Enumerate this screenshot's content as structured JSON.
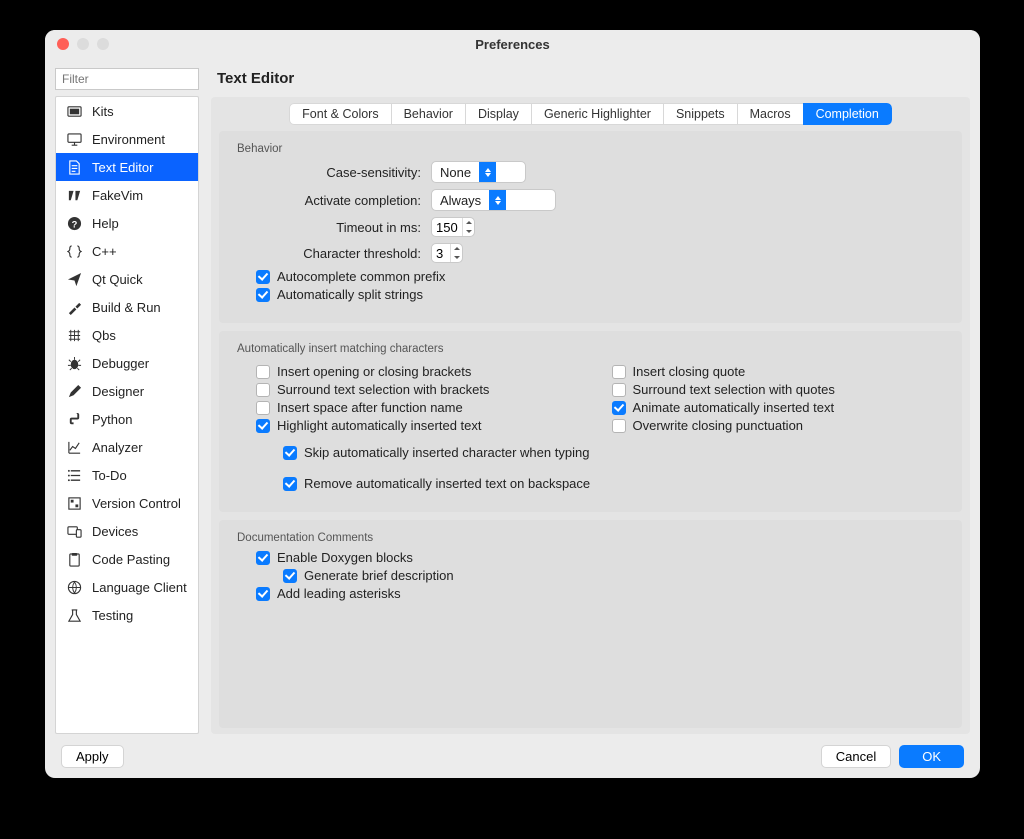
{
  "window": {
    "title": "Preferences"
  },
  "filter": {
    "placeholder": "Filter"
  },
  "sidebar": {
    "items": [
      {
        "label": "Kits"
      },
      {
        "label": "Environment"
      },
      {
        "label": "Text Editor"
      },
      {
        "label": "FakeVim"
      },
      {
        "label": "Help"
      },
      {
        "label": "C++"
      },
      {
        "label": "Qt Quick"
      },
      {
        "label": "Build & Run"
      },
      {
        "label": "Qbs"
      },
      {
        "label": "Debugger"
      },
      {
        "label": "Designer"
      },
      {
        "label": "Python"
      },
      {
        "label": "Analyzer"
      },
      {
        "label": "To-Do"
      },
      {
        "label": "Version Control"
      },
      {
        "label": "Devices"
      },
      {
        "label": "Code Pasting"
      },
      {
        "label": "Language Client"
      },
      {
        "label": "Testing"
      }
    ],
    "active_index": 2
  },
  "main": {
    "title": "Text Editor",
    "tabs": [
      {
        "label": "Font & Colors"
      },
      {
        "label": "Behavior"
      },
      {
        "label": "Display"
      },
      {
        "label": "Generic Highlighter"
      },
      {
        "label": "Snippets"
      },
      {
        "label": "Macros"
      },
      {
        "label": "Completion"
      }
    ],
    "active_tab": 6
  },
  "behavior_section": {
    "heading": "Behavior",
    "case_sensitivity_label": "Case-sensitivity:",
    "case_sensitivity_value": "None",
    "activate_completion_label": "Activate completion:",
    "activate_completion_value": "Always",
    "timeout_label": "Timeout in ms:",
    "timeout_value": "150",
    "char_threshold_label": "Character threshold:",
    "char_threshold_value": "3",
    "autocomplete_common_prefix": "Autocomplete common prefix",
    "auto_split_strings": "Automatically split strings"
  },
  "auto_insert_section": {
    "heading": "Automatically insert matching characters",
    "left": {
      "insert_brackets": "Insert opening or closing brackets",
      "surround_brackets": "Surround text selection with brackets",
      "space_after_func": "Insert space after function name",
      "highlight_auto_text": "Highlight automatically inserted text"
    },
    "right": {
      "insert_closing_quote": "Insert closing quote",
      "surround_quotes": "Surround text selection with quotes",
      "animate_auto_text": "Animate automatically inserted text",
      "overwrite_punctuation": "Overwrite closing punctuation"
    },
    "skip_auto_char": "Skip automatically inserted character when typing",
    "remove_auto_backspace": "Remove automatically inserted text on backspace"
  },
  "doc_section": {
    "heading": "Documentation Comments",
    "enable_doxygen": "Enable Doxygen blocks",
    "generate_brief": "Generate brief description",
    "leading_asterisks": "Add leading asterisks"
  },
  "buttons": {
    "apply": "Apply",
    "cancel": "Cancel",
    "ok": "OK"
  }
}
